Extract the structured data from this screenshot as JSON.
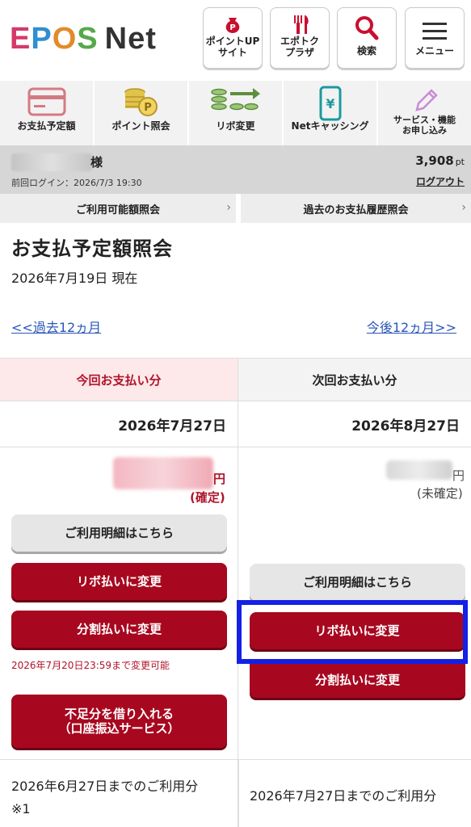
{
  "header": {
    "logo_letters": [
      "E",
      "P",
      "O",
      "S"
    ],
    "logo_net": "Net",
    "buttons": [
      {
        "label": "ポイントUP\nサイト",
        "icon": "point-bag-icon"
      },
      {
        "label": "エポトク\nプラザ",
        "icon": "fork-knife-icon"
      },
      {
        "label": "検索",
        "icon": "search-icon"
      },
      {
        "label": "メニュー",
        "icon": "hamburger-menu-icon"
      }
    ]
  },
  "nav": {
    "items": [
      {
        "label": "お支払予定額",
        "icon": "card-icon"
      },
      {
        "label": "ポイント照会",
        "icon": "coins-icon"
      },
      {
        "label": "リボ変更",
        "icon": "revolving-arrow-icon"
      },
      {
        "label": "Netキャッシング",
        "icon": "phone-yen-icon"
      },
      {
        "label": "サービス・機能\nお申し込み",
        "icon": "pencil-icon"
      }
    ]
  },
  "user": {
    "suffix": "様",
    "last_login": "前回ログイン：2026/7/3 19:30",
    "points": "3,908",
    "points_unit": "pt",
    "logout": "ログアウト"
  },
  "sublinks": {
    "available": "ご利用可能額照会",
    "history": "過去のお支払履歴照会"
  },
  "page": {
    "title": "お支払予定額照会",
    "as_of": "2026年7月19日 現在",
    "prev": "<<過去12ヵ月",
    "next": "今後12ヵ月>>"
  },
  "current": {
    "header": "今回お支払い分",
    "date": "2026年7月27日",
    "yen": "円",
    "status": "(確定)",
    "detail_btn": "ご利用明細はこちら",
    "revo_btn": "リボ払いに変更",
    "split_btn": "分割払いに変更",
    "deadline": "2026年7月20日23:59まで変更可能",
    "borrow_btn_line1": "不足分を借り入れる",
    "borrow_btn_line2": "（口座振込サービス）",
    "usage": "2026年6月27日までのご利用分",
    "usage_note": "※1"
  },
  "next_payment": {
    "header": "次回お支払い分",
    "date": "2026年8月27日",
    "yen": "円",
    "status": "(未確定)",
    "detail_btn": "ご利用明細はこちら",
    "revo_btn": "リボ払いに変更",
    "split_btn": "分割払いに変更",
    "usage": "2026年7月27日までのご利用分"
  },
  "colors": {
    "brand_red": "#a7081f",
    "highlight_blue": "#1420e6",
    "link_blue": "#2a57b8"
  }
}
